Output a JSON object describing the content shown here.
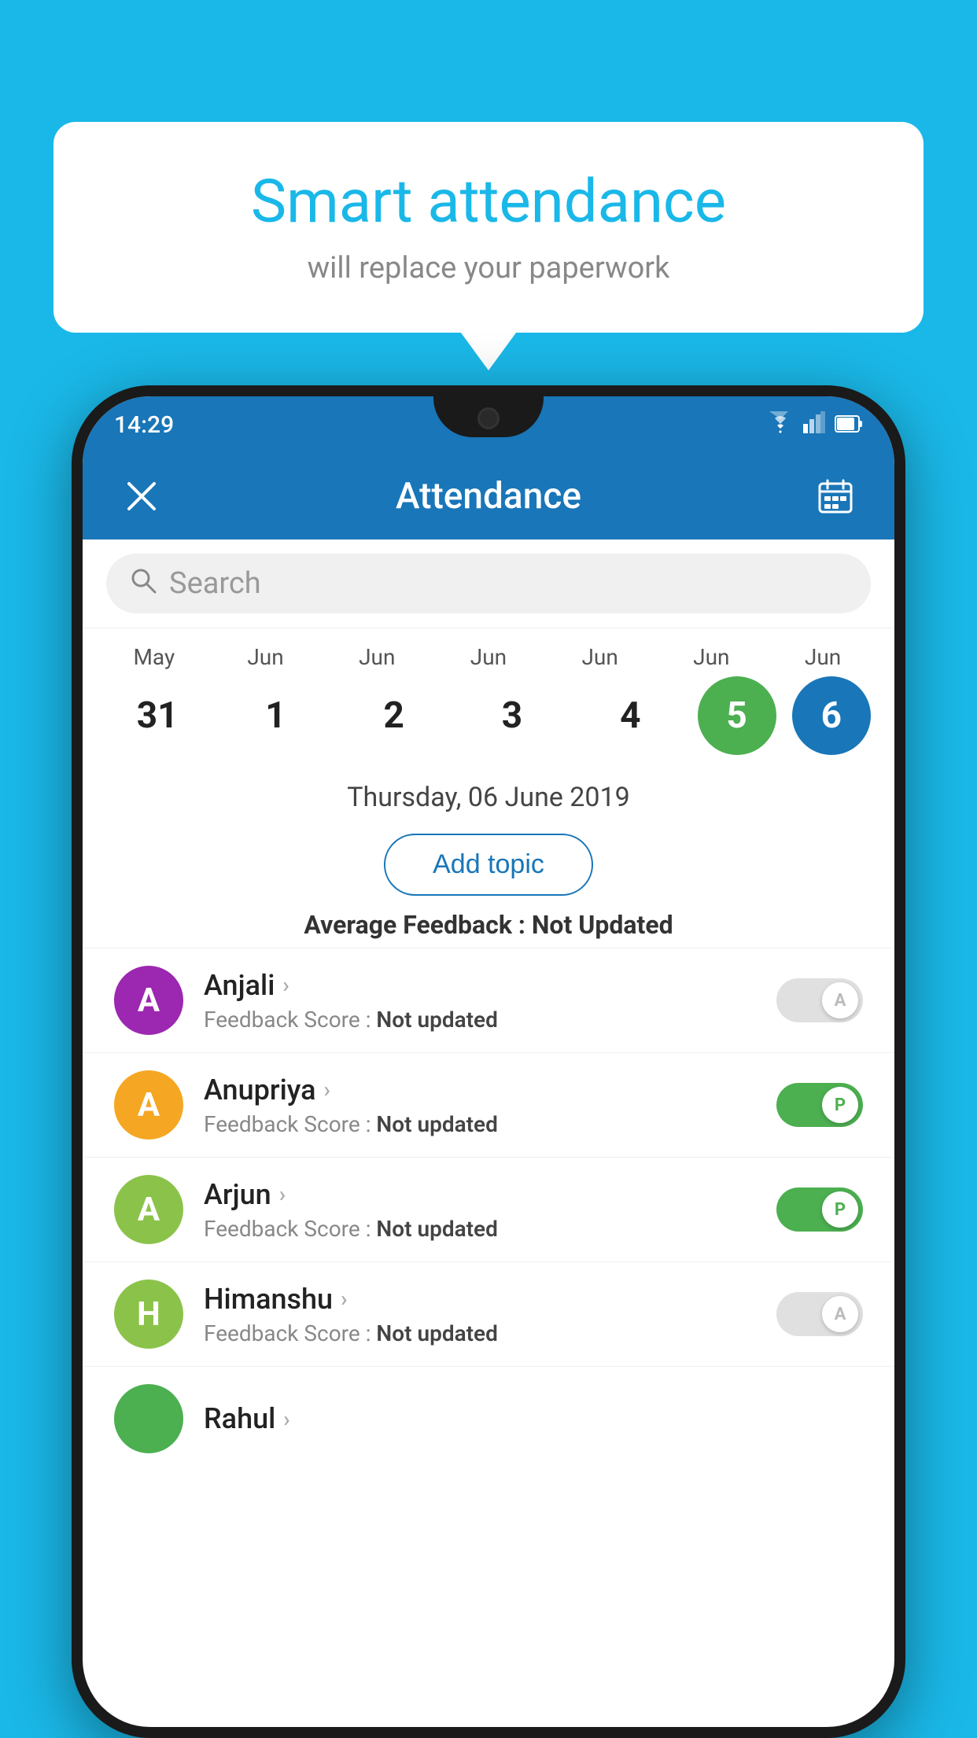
{
  "page": {
    "bg_color": "#1ab8e8"
  },
  "bubble": {
    "title": "Smart attendance",
    "subtitle": "will replace your paperwork"
  },
  "status_bar": {
    "time": "14:29",
    "icons": [
      "wifi",
      "signal",
      "battery"
    ]
  },
  "app_bar": {
    "title": "Attendance",
    "close_label": "×",
    "calendar_icon": "📅"
  },
  "search": {
    "placeholder": "Search"
  },
  "calendar": {
    "months": [
      "May",
      "Jun",
      "Jun",
      "Jun",
      "Jun",
      "Jun",
      "Jun"
    ],
    "dates": [
      "31",
      "1",
      "2",
      "3",
      "4",
      "5",
      "6"
    ],
    "today_index": 5,
    "selected_index": 6
  },
  "selected_date_label": "Thursday, 06 June 2019",
  "add_topic_label": "Add topic",
  "avg_feedback_label": "Average Feedback :",
  "avg_feedback_value": "Not Updated",
  "students": [
    {
      "name": "Anjali",
      "initial": "A",
      "avatar_color": "#9c27b0",
      "feedback_label": "Feedback Score :",
      "feedback_value": "Not updated",
      "attendance": "A",
      "present": false
    },
    {
      "name": "Anupriya",
      "initial": "A",
      "avatar_color": "#f5a623",
      "feedback_label": "Feedback Score :",
      "feedback_value": "Not updated",
      "attendance": "P",
      "present": true
    },
    {
      "name": "Arjun",
      "initial": "A",
      "avatar_color": "#8bc34a",
      "feedback_label": "Feedback Score :",
      "feedback_value": "Not updated",
      "attendance": "P",
      "present": true
    },
    {
      "name": "Himanshu",
      "initial": "H",
      "avatar_color": "#8bc34a",
      "feedback_label": "Feedback Score :",
      "feedback_value": "Not updated",
      "attendance": "A",
      "present": false
    }
  ]
}
